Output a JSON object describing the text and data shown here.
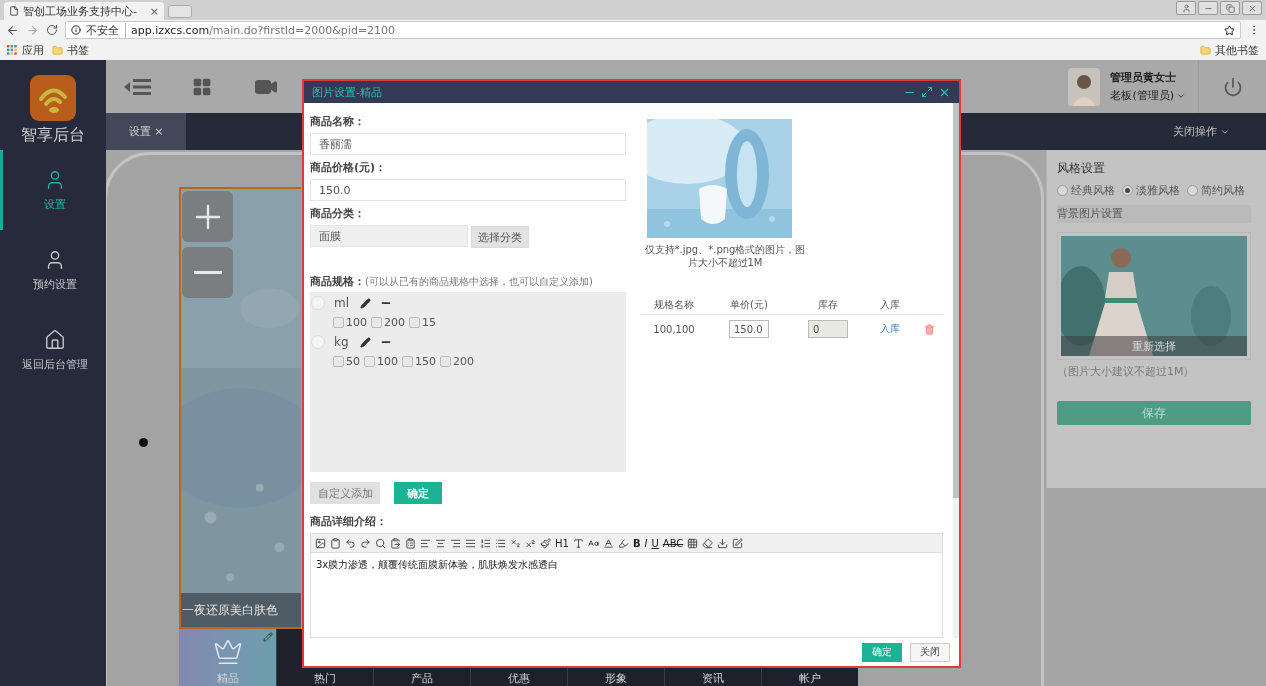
{
  "browser": {
    "tab_title": "智创工场业务支持中心-",
    "tab_close": "×",
    "security": "不安全",
    "url_host": "app.izxcs.com",
    "url_path": "/main.do?firstId=2000&pid=2100",
    "bookmarks": [
      "应用",
      "书签"
    ],
    "other_bookmarks": "其他书签"
  },
  "sidebar": {
    "brand": "智享后台",
    "items": [
      {
        "label": "设置",
        "selected": true
      },
      {
        "label": "预约设置",
        "selected": false
      },
      {
        "label": "返回后台管理",
        "selected": false
      }
    ]
  },
  "topbar": {
    "user_name": "管理员黄女士",
    "user_role": "老板(管理员)"
  },
  "tabs": [
    {
      "label": "设置",
      "close": "×",
      "selected": true
    }
  ],
  "tab_action": "关闭操作",
  "preview": {
    "caption": "一夜还原美白肤色",
    "nav": [
      {
        "label": "精品",
        "selected": true
      },
      {
        "label": "热门",
        "selected": false
      },
      {
        "label": "产品",
        "selected": false
      },
      {
        "label": "优惠",
        "selected": false
      },
      {
        "label": "形象",
        "selected": false
      },
      {
        "label": "资讯",
        "selected": false
      },
      {
        "label": "帐户",
        "selected": false
      }
    ]
  },
  "style_panel": {
    "title": "风格设置",
    "styles": [
      {
        "label": "经典风格",
        "selected": false
      },
      {
        "label": "淡雅风格",
        "selected": true
      },
      {
        "label": "简约风格",
        "selected": false
      }
    ],
    "background_title": "背景图片设置",
    "reselect": "重新选择",
    "hint": "（图片大小建议不超过1M）",
    "save": "保存"
  },
  "dialog": {
    "title": "图片设置-精品",
    "name_label": "商品名称：",
    "name_value": "香丽濡",
    "price_label": "商品价格(元)：",
    "price_value": "150.0",
    "category_label": "商品分类：",
    "category_value": "面膜",
    "category_button": "选择分类",
    "spec_label": "商品规格：",
    "spec_hint": "(可以从已有的商品规格中选择，也可以自定义添加)",
    "specs": [
      {
        "unit": "ml",
        "selected": false,
        "values": [
          {
            "label": "100",
            "checked": false
          },
          {
            "label": "200",
            "checked": false
          },
          {
            "label": "15",
            "checked": false
          }
        ]
      },
      {
        "unit": "kg",
        "selected": false,
        "values": [
          {
            "label": "50",
            "checked": false
          },
          {
            "label": "100",
            "checked": false
          },
          {
            "label": "150",
            "checked": false
          },
          {
            "label": "200",
            "checked": false
          }
        ]
      }
    ],
    "custom_add": "自定义添加",
    "confirm_spec": "确定",
    "image_hint": "仅支持*.jpg、*.png格式的图片，图片大小不超过1M",
    "table": {
      "columns": [
        "规格名称",
        "单价(元)",
        "库存",
        "入库"
      ],
      "rows": [
        {
          "name": "100,100",
          "price": "150.0",
          "stock": "0",
          "action": "入库"
        }
      ]
    },
    "description_label": "商品详细介绍：",
    "toolbar": [
      {
        "kind": "icon"
      },
      {
        "kind": "icon"
      },
      {
        "kind": "icon"
      },
      {
        "kind": "icon"
      },
      {
        "kind": "icon"
      },
      {
        "kind": "icon"
      },
      {
        "kind": "icon"
      },
      {
        "kind": "icon"
      },
      {
        "kind": "icon"
      },
      {
        "kind": "icon"
      },
      {
        "kind": "icon"
      },
      {
        "kind": "icon"
      },
      {
        "kind": "icon"
      },
      {
        "kind": "icon"
      },
      {
        "kind": "icon"
      },
      {
        "kind": "icon"
      },
      {
        "kind": "text",
        "label": "H1"
      },
      {
        "kind": "icon"
      },
      {
        "kind": "icon"
      },
      {
        "kind": "icon"
      },
      {
        "kind": "icon"
      },
      {
        "kind": "bold",
        "label": "B"
      },
      {
        "kind": "italic",
        "label": "I"
      },
      {
        "kind": "underline",
        "label": "U"
      },
      {
        "kind": "strike",
        "label": "ABC"
      },
      {
        "kind": "icon"
      },
      {
        "kind": "icon"
      },
      {
        "kind": "icon"
      },
      {
        "kind": "icon"
      }
    ],
    "description": "3x膜力渗透，颠覆传统面膜新体验，肌肤焕发水感透白",
    "buttons": [
      {
        "label": "确定",
        "kind": "primary"
      },
      {
        "label": "关闭",
        "kind": "plain"
      }
    ]
  }
}
